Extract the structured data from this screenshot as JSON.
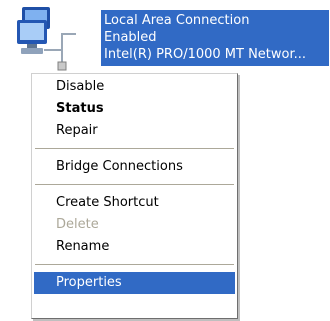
{
  "connection": {
    "name": "Local Area Connection",
    "status": "Enabled",
    "device": "Intel(R) PRO/1000 MT Networ..."
  },
  "icon": {
    "name": "network-connection-icon"
  },
  "menu": {
    "disable": "Disable",
    "status": "Status",
    "repair": "Repair",
    "bridge": "Bridge Connections",
    "create_shortcut": "Create Shortcut",
    "delete": "Delete",
    "rename": "Rename",
    "properties": "Properties"
  },
  "colors": {
    "selection": "#316ac5",
    "disabled_text": "#aca899",
    "separator": "#aca899"
  }
}
